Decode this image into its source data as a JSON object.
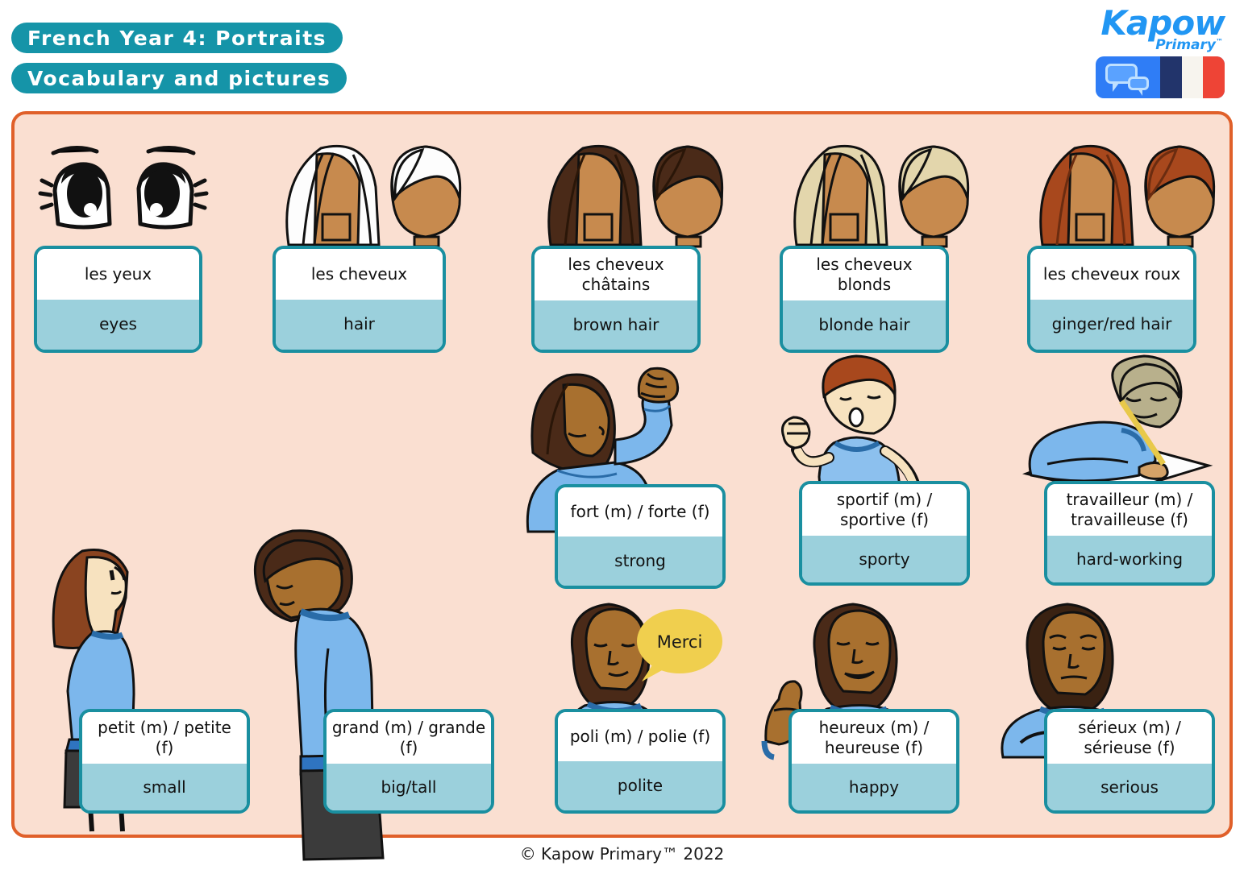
{
  "header": {
    "title_line1": "French Year 4: Portraits",
    "title_line2": "Vocabulary and pictures",
    "logo_name": "Kapow",
    "logo_sub": "Primary",
    "logo_tm": "™",
    "badge_icon": "speech-bubbles-icon",
    "flag_icon": "french-flag-icon",
    "colors": {
      "banner": "#1594a8",
      "logo": "#2196f3",
      "flag_blue": "#22346b",
      "flag_white": "#f7f4ee",
      "flag_red": "#ee4436"
    }
  },
  "board": {
    "background": "#fadfd1",
    "border": "#e0602a"
  },
  "card_style": {
    "border": "#1a8fa0",
    "french_bg": "#ffffff",
    "english_bg": "#9bd0dc"
  },
  "speech_bubble": {
    "text": "Merci",
    "color": "#f0cf4e"
  },
  "cards": [
    {
      "id": "les-yeux",
      "french": "les yeux",
      "english": "eyes",
      "illustration": "eyes-icon"
    },
    {
      "id": "les-cheveux",
      "french": "les cheveux",
      "english": "hair",
      "illustration": "white-hair-heads-icon"
    },
    {
      "id": "cheveux-chatains",
      "french": "les cheveux châtains",
      "english": "brown hair",
      "illustration": "brown-hair-heads-icon"
    },
    {
      "id": "cheveux-blonds",
      "french": "les cheveux blonds",
      "english": "blonde hair",
      "illustration": "blonde-hair-heads-icon"
    },
    {
      "id": "cheveux-roux",
      "french": "les cheveux roux",
      "english": "ginger/red hair",
      "illustration": "ginger-hair-heads-icon"
    },
    {
      "id": "fort",
      "french": "fort (m) / forte (f)",
      "english": "strong",
      "illustration": "flexing-arm-figure-icon"
    },
    {
      "id": "sportif",
      "french": "sportif (m) / sportive (f)",
      "english": "sporty",
      "illustration": "running-figure-icon"
    },
    {
      "id": "travailleur",
      "french": "travailleur (m) / travailleuse (f)",
      "english": "hard-working",
      "illustration": "writing-figure-icon"
    },
    {
      "id": "petit",
      "french": "petit (m) / petite (f)",
      "english": "small",
      "illustration": "small-girl-figure-icon"
    },
    {
      "id": "grand",
      "french": "grand (m) / grande (f)",
      "english": "big/tall",
      "illustration": "tall-boy-figure-icon"
    },
    {
      "id": "poli",
      "french": "poli (m) / polie (f)",
      "english": "polite",
      "illustration": "polite-figure-icon"
    },
    {
      "id": "heureux",
      "french": "heureux (m) / heureuse (f)",
      "english": "happy",
      "illustration": "happy-figure-icon"
    },
    {
      "id": "serieux",
      "french": "sérieux (m) / sérieuse (f)",
      "english": "serious",
      "illustration": "serious-figure-icon"
    }
  ],
  "footer": "© Kapow Primary™ 2022"
}
